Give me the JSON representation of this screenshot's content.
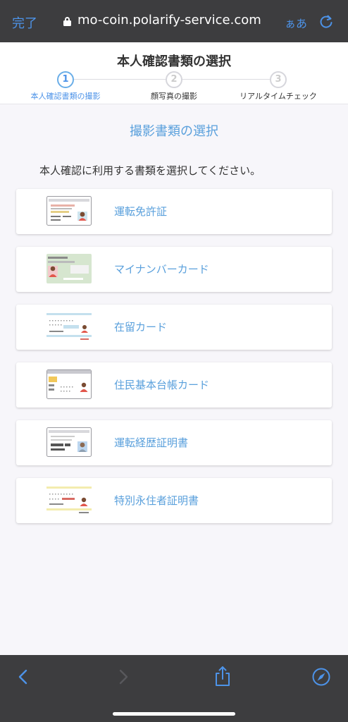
{
  "browser": {
    "done_label": "完了",
    "url": "mo-coin.polarify-service.com",
    "text_size_label": "ぁあ"
  },
  "header": {
    "title": "本人確認書類の選択",
    "steps": [
      {
        "number": "1",
        "label": "本人確認書類の撮影"
      },
      {
        "number": "2",
        "label": "顔写真の撮影"
      },
      {
        "number": "3",
        "label": "リアルタイムチェック"
      }
    ]
  },
  "main": {
    "section_title": "撮影書類の選択",
    "instruction": "本人確認に利用する書類を選択してください。",
    "documents": [
      {
        "label": "運転免許証",
        "icon": "drivers-license-icon"
      },
      {
        "label": "マイナンバーカード",
        "icon": "my-number-card-icon"
      },
      {
        "label": "在留カード",
        "icon": "residence-card-icon"
      },
      {
        "label": "住民基本台帳カード",
        "icon": "resident-registry-card-icon"
      },
      {
        "label": "運転経歴証明書",
        "icon": "driving-history-certificate-icon"
      },
      {
        "label": "特別永住者証明書",
        "icon": "special-permanent-resident-certificate-icon"
      }
    ]
  },
  "colors": {
    "accent": "#4d93e8",
    "link": "#5aa0dc",
    "browser_chrome": "#3d3d3f",
    "page_background": "#f7f6fa"
  }
}
